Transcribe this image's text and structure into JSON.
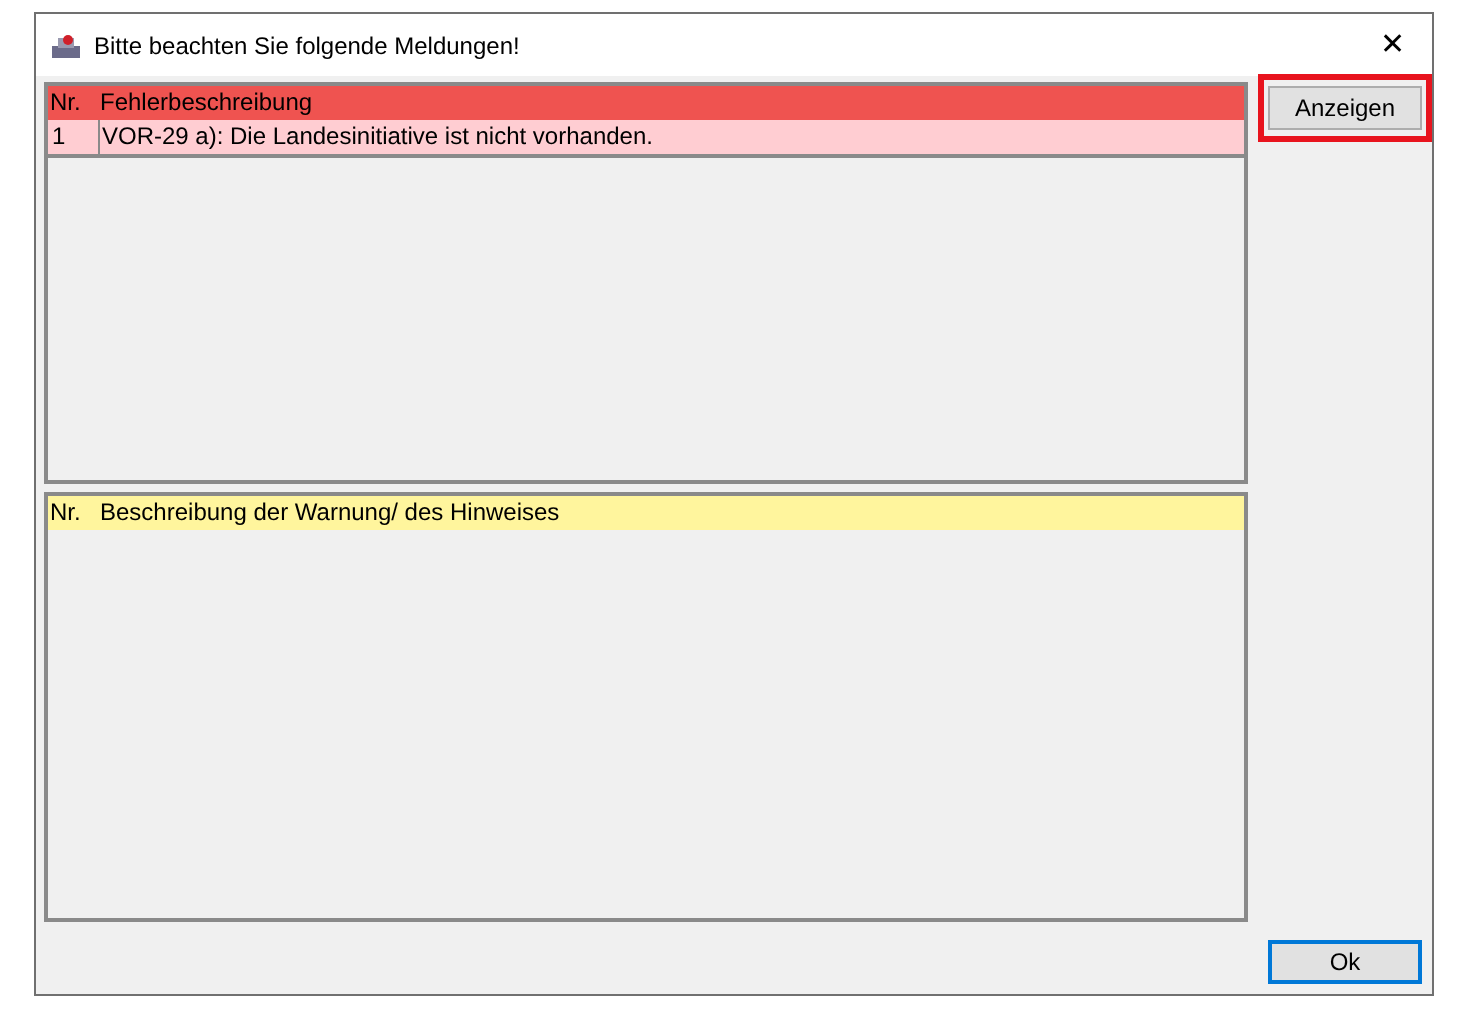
{
  "window": {
    "title": "Bitte beachten Sie folgende Meldungen!",
    "close": "✕"
  },
  "errors": {
    "columns": [
      "Nr.",
      "Fehlerbeschreibung"
    ],
    "rows": [
      {
        "cells": [
          "1",
          "VOR-29 a): Die Landesinitiative ist nicht vorhanden."
        ]
      }
    ]
  },
  "warnings": {
    "columns": [
      "Nr.",
      "Beschreibung der Warnung/ des Hinweises"
    ]
  },
  "buttons": [
    {
      "label": "Anzeigen",
      "highlighted": true,
      "default": false
    },
    {
      "label": "Ok",
      "highlighted": false,
      "default": true
    }
  ]
}
